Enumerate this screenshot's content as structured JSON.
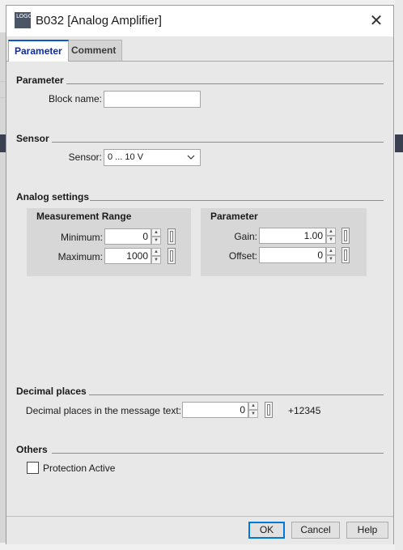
{
  "window": {
    "icon_text": "LOGO",
    "title": "B032 [Analog Amplifier]",
    "close_glyph": "✕"
  },
  "tabs": [
    {
      "label": "Parameter"
    },
    {
      "label": "Comment"
    }
  ],
  "parameter_section": {
    "title": "Parameter",
    "block_name_label": "Block name:",
    "block_name_value": ""
  },
  "sensor_section": {
    "title": "Sensor",
    "sensor_label": "Sensor:",
    "sensor_value": "0 ... 10 V"
  },
  "analog_section": {
    "title": "Analog settings",
    "measurement": {
      "title": "Measurement Range",
      "min_label": "Minimum:",
      "min_value": "0",
      "max_label": "Maximum:",
      "max_value": "1000"
    },
    "parameter": {
      "title": "Parameter",
      "gain_label": "Gain:",
      "gain_value": "1.00",
      "offset_label": "Offset:",
      "offset_value": "0"
    }
  },
  "decimal_section": {
    "title": "Decimal places",
    "label": "Decimal places in the message text:",
    "value": "0",
    "preview": "+12345"
  },
  "others_section": {
    "title": "Others",
    "protection_label": "Protection Active",
    "protection_checked": false
  },
  "footer": {
    "ok": "OK",
    "cancel": "Cancel",
    "help": "Help"
  },
  "colors": {
    "accent": "#0078d7",
    "active_tab_text": "#0a2bb0",
    "panel_bg": "#d7d7d7"
  }
}
